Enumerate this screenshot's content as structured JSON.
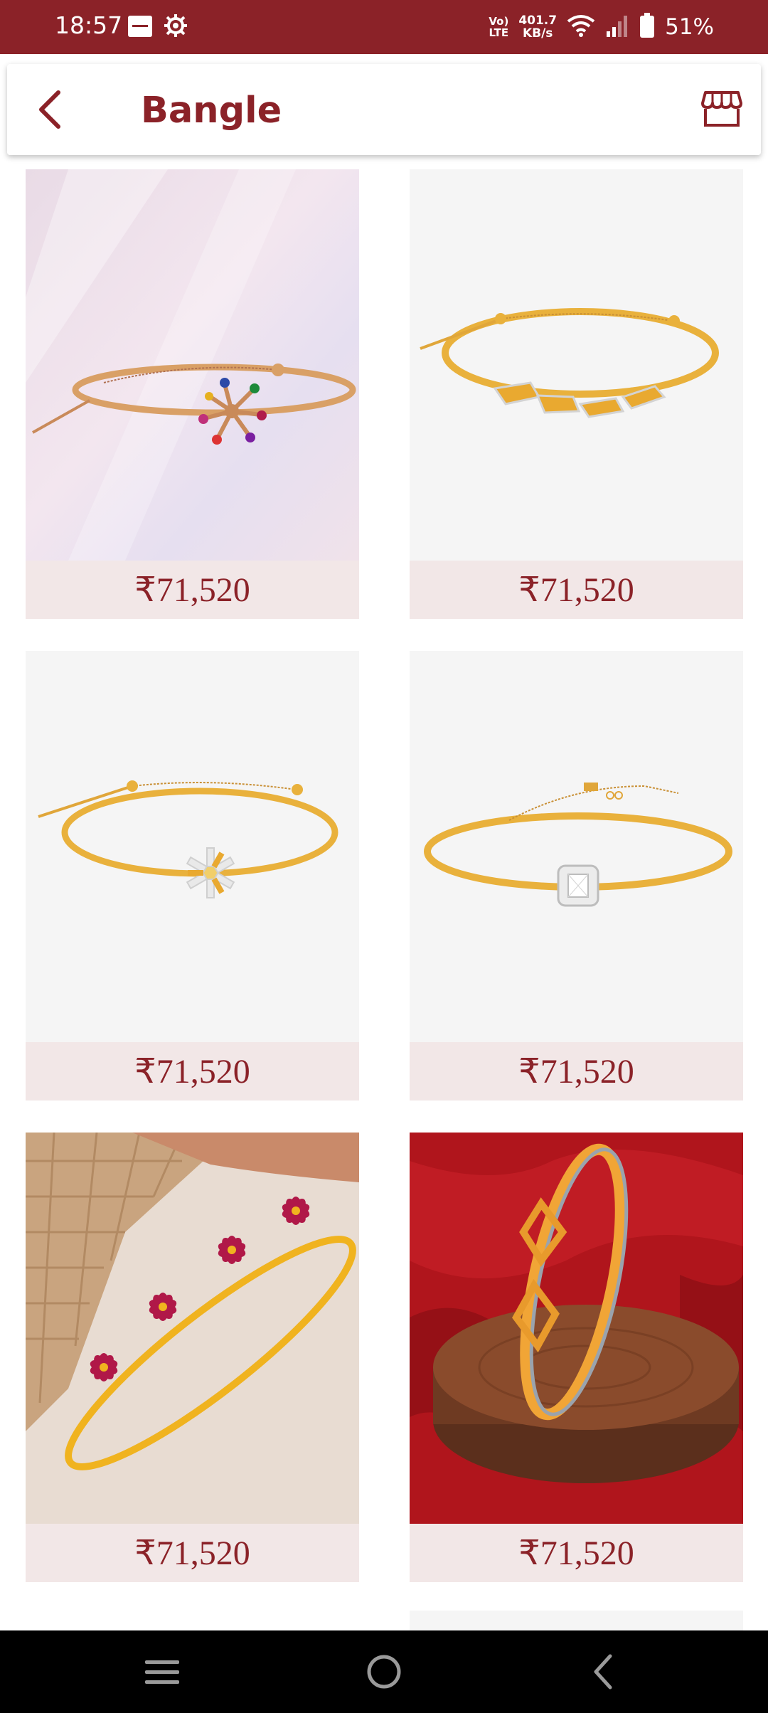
{
  "status_bar": {
    "time": "18:57",
    "volte_top": "Vo)",
    "volte_bottom": "LTE",
    "speed_value": "401.7",
    "speed_unit": "KB/s",
    "battery": "51%"
  },
  "header": {
    "title": "Bangle",
    "back_icon": "chevron-left-icon",
    "store_icon": "store-icon"
  },
  "colors": {
    "brand": "#8b2228",
    "price_bg": "#f2e7e7"
  },
  "products": [
    {
      "price": "₹71,520",
      "style": "pink-backdrop-gold-bangle-with-multicolor-gem-flower"
    },
    {
      "price": "₹71,520",
      "style": "gold-bangle-with-zigzag-links"
    },
    {
      "price": "₹71,520",
      "style": "gold-bangle-with-diamond-flower"
    },
    {
      "price": "₹71,520",
      "style": "gold-bangle-with-square-diamond"
    },
    {
      "price": "₹71,520",
      "style": "gold-bangle-with-ruby-flowers"
    },
    {
      "price": "₹71,520",
      "style": "gold-kada-on-wooden-stand"
    }
  ],
  "nav": {
    "menu_icon": "menu-icon",
    "home_icon": "home-circle-icon",
    "back_icon": "back-chevron-icon"
  }
}
